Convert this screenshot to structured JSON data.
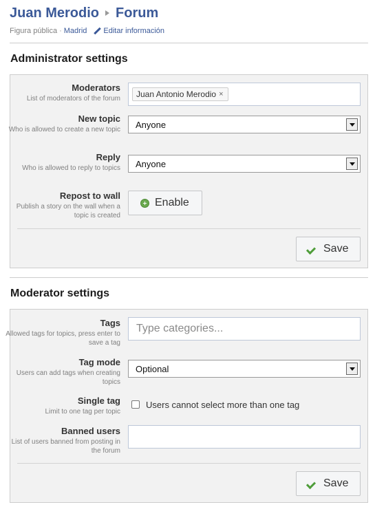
{
  "header": {
    "name": "Juan Merodio",
    "page": "Forum",
    "category": "Figura pública",
    "location": "Madrid",
    "edit_link": "Editar información"
  },
  "admin": {
    "title": "Administrator settings",
    "moderators": {
      "label": "Moderators",
      "desc": "List of moderators of the forum",
      "token": "Juan Antonio Merodio",
      "token_remove": "×"
    },
    "new_topic": {
      "label": "New topic",
      "desc": "Who is allowed to create a new topic",
      "value": "Anyone"
    },
    "reply": {
      "label": "Reply",
      "desc": "Who is allowed to reply to topics",
      "value": "Anyone"
    },
    "repost": {
      "label": "Repost to wall",
      "desc": "Publish a story on the wall when a topic is created",
      "button": "Enable"
    },
    "save": "Save"
  },
  "moderator": {
    "title": "Moderator settings",
    "tags": {
      "label": "Tags",
      "desc": "Allowed tags for topics, press enter to save a tag",
      "placeholder": "Type categories..."
    },
    "tag_mode": {
      "label": "Tag mode",
      "desc": "Users can add tags when creating topics",
      "value": "Optional"
    },
    "single_tag": {
      "label": "Single tag",
      "desc": "Limit to one tag per topic",
      "checkbox_label": "Users cannot select more than one tag",
      "checked": false
    },
    "banned": {
      "label": "Banned users",
      "desc": "List of users banned from posting in the forum",
      "value": ""
    },
    "save": "Save"
  },
  "colors": {
    "link": "#3b5998",
    "panel_bg": "#f2f2f2",
    "check_green": "#4f9d3a"
  }
}
